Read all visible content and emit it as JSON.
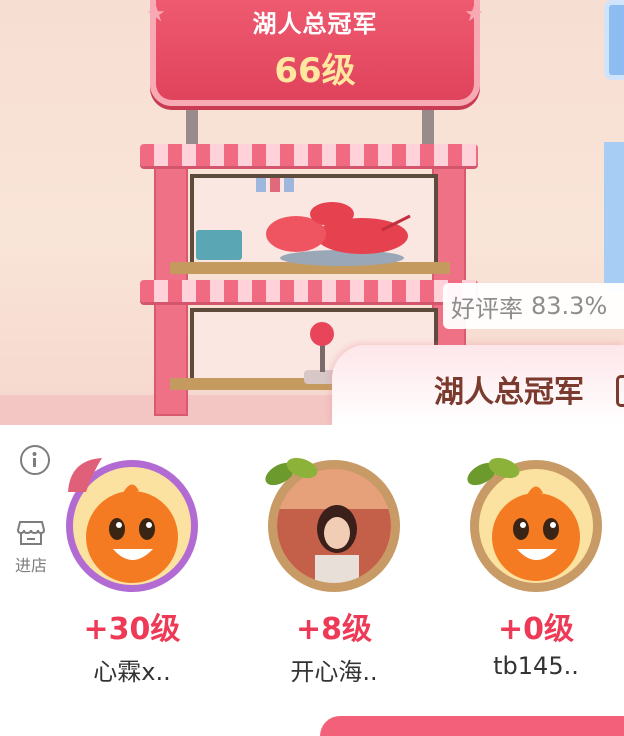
{
  "sign": {
    "title": "湖人总冠军",
    "level": "66级"
  },
  "rating": {
    "label": "好评率",
    "value": "83.3%"
  },
  "name_tab": {
    "title": "湖人总冠军"
  },
  "sidebar": {
    "shop_label": "进店"
  },
  "members": [
    {
      "level": "+30级",
      "name": "心霖x..",
      "avatar": "orange-mascot"
    },
    {
      "level": "+8级",
      "name": "开心海..",
      "avatar": "photo"
    },
    {
      "level": "+0级",
      "name": "tb145..",
      "avatar": "orange-mascot"
    }
  ],
  "colors": {
    "accent": "#ee3a57",
    "sign_red": "#e0435c",
    "brand_brown": "#7a3a2e"
  }
}
